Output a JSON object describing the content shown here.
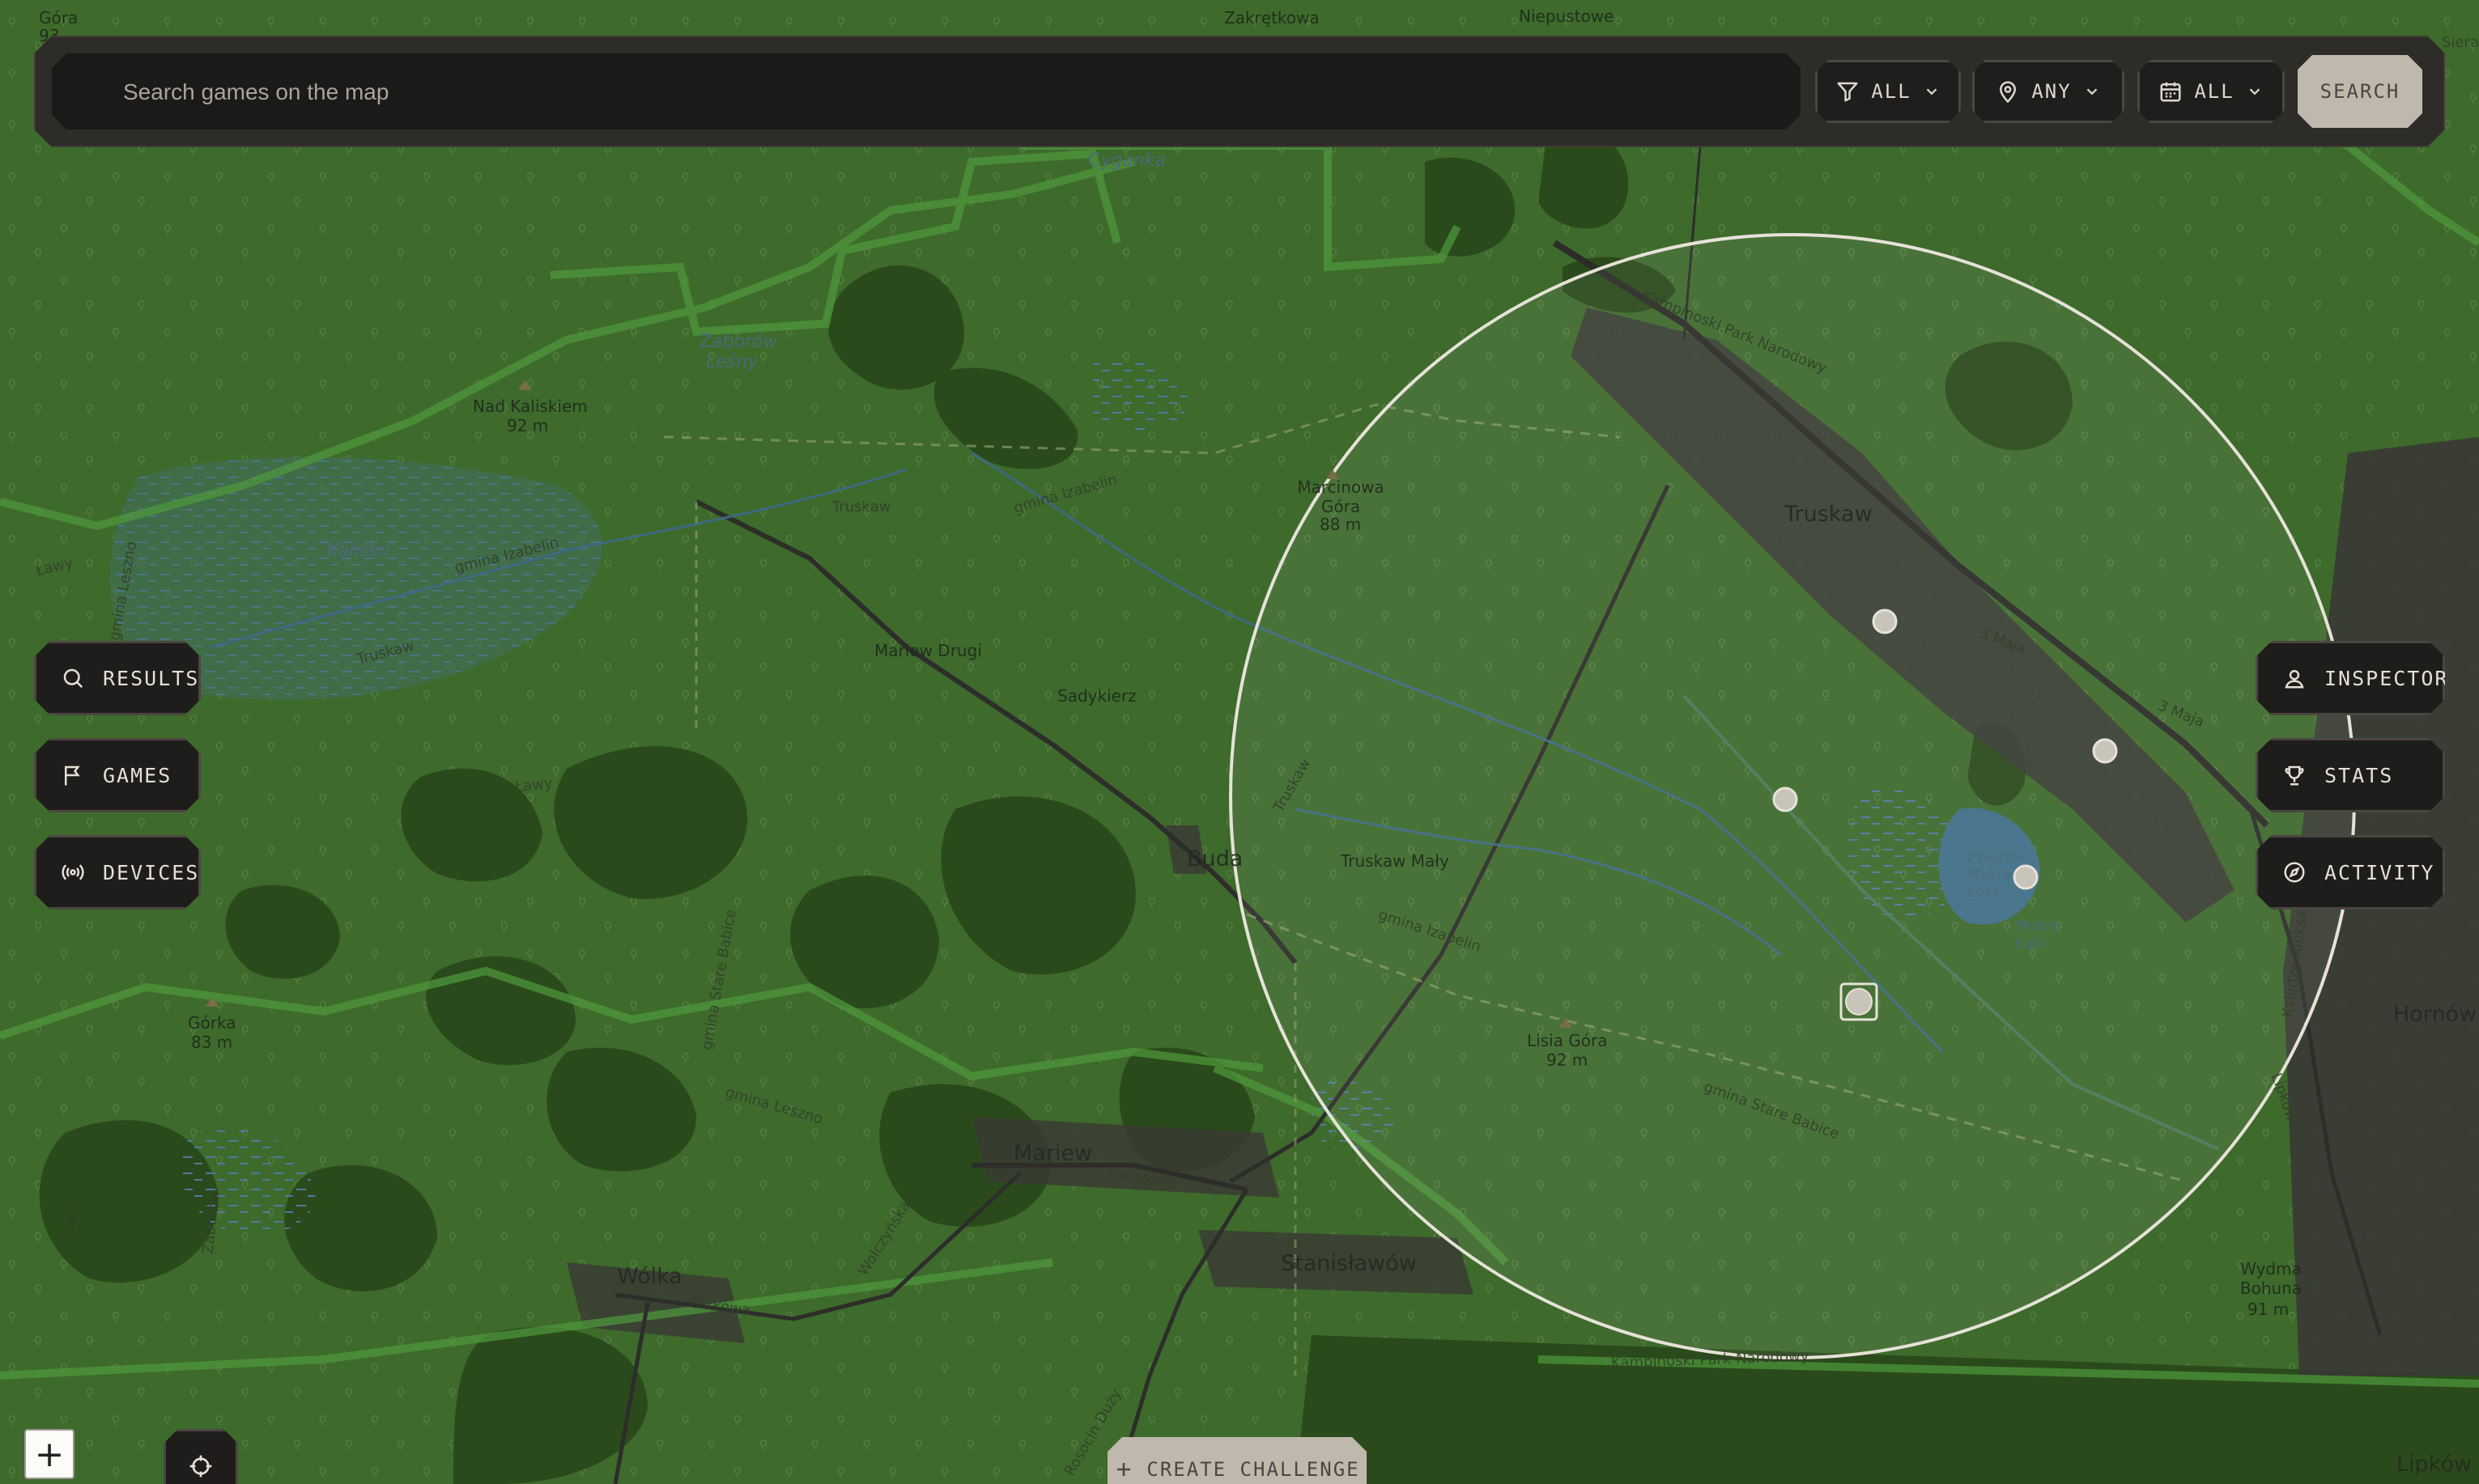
{
  "search": {
    "placeholder": "Search games on the map",
    "button_label": "SEARCH"
  },
  "filters": {
    "type": {
      "icon": "filter-icon",
      "value": "ALL"
    },
    "location": {
      "icon": "map-pin-icon",
      "value": "ANY"
    },
    "date": {
      "icon": "calendar-icon",
      "value": "ALL"
    }
  },
  "left_panel": [
    {
      "icon": "search-icon",
      "label": "RESULTS"
    },
    {
      "icon": "flag-icon",
      "label": "GAMES"
    },
    {
      "icon": "broadcast-icon",
      "label": "DEVICES"
    }
  ],
  "right_panel": [
    {
      "icon": "user-pin-icon",
      "label": "INSPECTOR"
    },
    {
      "icon": "trophy-icon",
      "label": "STATS"
    },
    {
      "icon": "compass-icon",
      "label": "ACTIVITY"
    }
  ],
  "map_controls": {
    "zoom_in_label": "+",
    "locate_icon": "crosshair-icon",
    "create_challenge_label": "CREATE CHALLENGE"
  },
  "map_labels": {
    "gora": "Góra",
    "n93": "93",
    "zakretkowa": "Zakrętkowa",
    "niepustowe": "Niepustowe",
    "cyganka": "Cyganka",
    "zaborow_lesny": "Zaborów Leśny",
    "nad_kaliskiem": "Nad Kaliskiem",
    "m92": "92 m",
    "truskaw_road": "Truskaw",
    "gmina_izabelin": "gmina Izabelin",
    "marcinowa_gora": "Marcinowa Góra",
    "m88": "88 m",
    "truskaw": "Truskaw",
    "kalisko": "Kalisko",
    "lawy": "Ławy",
    "gmina_leszno": "gmina Leszno",
    "mariew_drugi": "Mariew Drugi",
    "sadykierz": "Sadykierz",
    "buda": "Buda",
    "truskaw_maly": "Truskaw Mały",
    "gmina_izabelin2": "gmina Izabelin",
    "maja3": "3 Maja",
    "gmina_stare_babice": "gmina Stare Babice",
    "zbiornik": "Zbiornik Mokre Łoki",
    "mokre_laki": "Mokre Łąki",
    "lisia_gora": "Lisia Góra",
    "gorka": "Górka",
    "m83": "83 m",
    "mariew": "Mariew",
    "kwiatowa": "Kwiatowa",
    "wolka": "Wólka",
    "parkowa": "Parkowa",
    "wolczynska": "Wołczyńska",
    "stanislawow": "Stanisławów",
    "kampinoski": "Kampinoski Park Narodowy",
    "wydma_bohuna": "Wydma Bohuna",
    "m91": "91 m",
    "hornow": "Hornów",
    "lipkow": "Lipków",
    "lipkowska": "Lipkowska",
    "kolejowa": "Księdza Aleksandra",
    "zaborowska": "Zaborów",
    "rosocin": "Rosocin Duży",
    "truskaw_vert": "Truskaw",
    "siera": "Siera"
  },
  "colors": {
    "map_base": "#3e6a2c",
    "forest": "#2c4a1c",
    "radius_ring": "#e6e2d8",
    "marker": "#c9c4ba"
  },
  "markers": [
    {
      "id": "game-marker-1",
      "selected": false
    },
    {
      "id": "game-marker-2",
      "selected": false
    },
    {
      "id": "game-marker-3",
      "selected": false
    },
    {
      "id": "game-marker-4",
      "selected": false
    },
    {
      "id": "game-marker-5",
      "selected": true
    }
  ]
}
